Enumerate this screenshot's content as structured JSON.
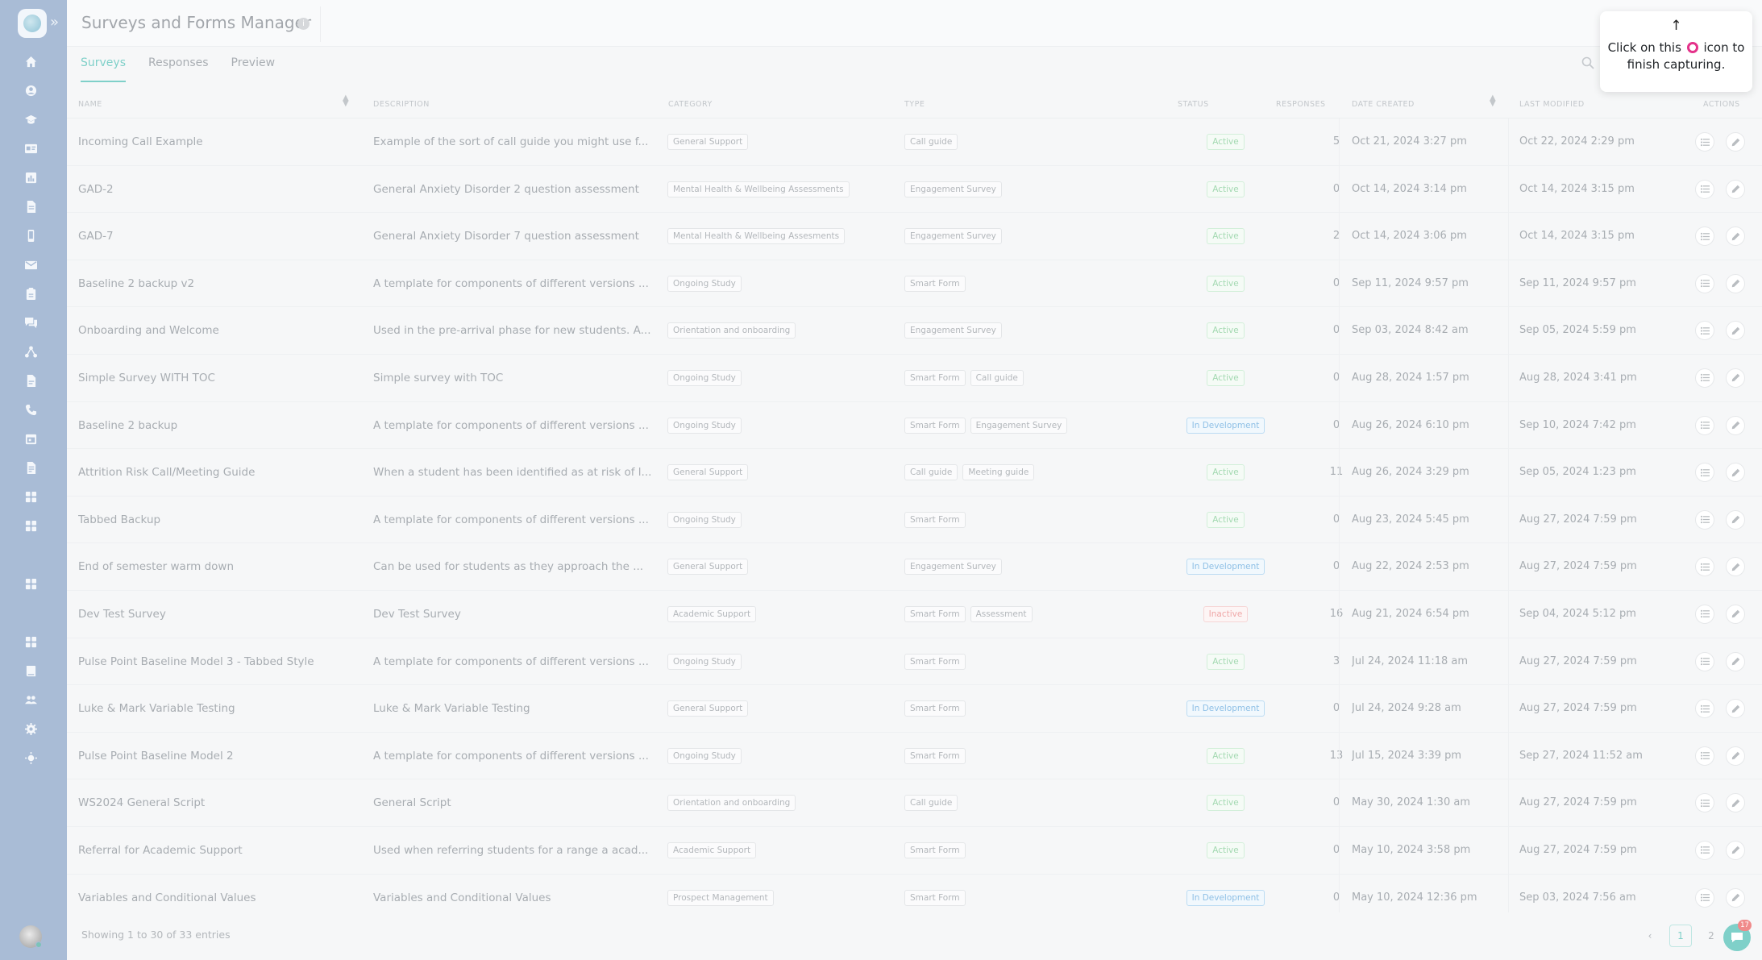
{
  "header": {
    "title": "Surveys and Forms Manager",
    "info_glyph": "i"
  },
  "tabs": [
    "Surveys",
    "Responses",
    "Preview"
  ],
  "columns": {
    "name": "NAME",
    "description": "DESCRIPTION",
    "category": "CATEGORY",
    "type": "TYPE",
    "status": "STATUS",
    "responses": "RESPONSES",
    "date_created": "DATE CREATED",
    "last_modified": "LAST MODIFIED",
    "actions": "ACTIONS"
  },
  "rows": [
    {
      "name": "Incoming Call Example",
      "description": "Example of the sort of call guide you might use f...",
      "category": "General Support",
      "types": [
        "Call guide"
      ],
      "status": "Active",
      "responses": "5",
      "created": "Oct 21, 2024 3:27 pm",
      "modified": "Oct 22, 2024 2:29 pm"
    },
    {
      "name": "GAD-2",
      "description": "General Anxiety Disorder 2 question assessment",
      "category": "Mental Health & Wellbeing Assessments",
      "types": [
        "Engagement Survey"
      ],
      "status": "Active",
      "responses": "0",
      "created": "Oct 14, 2024 3:14 pm",
      "modified": "Oct 14, 2024 3:15 pm"
    },
    {
      "name": "GAD-7",
      "description": "General Anxiety Disorder 7 question assessment",
      "category": "Mental Health & Wellbeing Assesments",
      "types": [
        "Engagement Survey"
      ],
      "status": "Active",
      "responses": "2",
      "created": "Oct 14, 2024 3:06 pm",
      "modified": "Oct 14, 2024 3:15 pm"
    },
    {
      "name": "Baseline 2 backup v2",
      "description": "A template for components of different versions ...",
      "category": "Ongoing Study",
      "types": [
        "Smart Form"
      ],
      "status": "Active",
      "responses": "0",
      "created": "Sep 11, 2024 9:57 pm",
      "modified": "Sep 11, 2024 9:57 pm"
    },
    {
      "name": "Onboarding and Welcome",
      "description": "Used in the pre-arrival phase for new students. A...",
      "category": "Orientation and onboarding",
      "types": [
        "Engagement Survey"
      ],
      "status": "Active",
      "responses": "0",
      "created": "Sep 03, 2024 8:42 am",
      "modified": "Sep 05, 2024 5:59 pm"
    },
    {
      "name": "Simple Survey WITH TOC",
      "description": "Simple survey with TOC",
      "category": "Ongoing Study",
      "types": [
        "Smart Form",
        "Call guide"
      ],
      "status": "Active",
      "responses": "0",
      "created": "Aug 28, 2024 1:57 pm",
      "modified": "Aug 28, 2024 3:41 pm"
    },
    {
      "name": "Baseline 2 backup",
      "description": "A template for components of different versions ...",
      "category": "Ongoing Study",
      "types": [
        "Smart Form",
        "Engagement Survey"
      ],
      "status": "In Development",
      "responses": "0",
      "created": "Aug 26, 2024 6:10 pm",
      "modified": "Sep 10, 2024 7:42 pm"
    },
    {
      "name": "Attrition Risk Call/Meeting Guide",
      "description": "When a student has been identified as at risk of l...",
      "category": "General Support",
      "types": [
        "Call guide",
        "Meeting guide"
      ],
      "status": "Active",
      "responses": "11",
      "created": "Aug 26, 2024 3:29 pm",
      "modified": "Sep 05, 2024 1:23 pm"
    },
    {
      "name": "Tabbed Backup",
      "description": "A template for components of different versions ...",
      "category": "Ongoing Study",
      "types": [
        "Smart Form"
      ],
      "status": "Active",
      "responses": "0",
      "created": "Aug 23, 2024 5:45 pm",
      "modified": "Aug 27, 2024 7:59 pm"
    },
    {
      "name": "End of semester warm down",
      "description": "Can be used for students as they approach the ...",
      "category": "General Support",
      "types": [
        "Engagement Survey"
      ],
      "status": "In Development",
      "responses": "0",
      "created": "Aug 22, 2024 2:53 pm",
      "modified": "Aug 27, 2024 7:59 pm"
    },
    {
      "name": "Dev Test Survey",
      "description": "Dev Test Survey",
      "category": "Academic Support",
      "types": [
        "Smart Form",
        "Assessment"
      ],
      "status": "Inactive",
      "responses": "16",
      "created": "Aug 21, 2024 6:54 pm",
      "modified": "Sep 04, 2024 5:12 pm"
    },
    {
      "name": "Pulse Point Baseline Model 3 - Tabbed Style",
      "description": "A template for components of different versions ...",
      "category": "Ongoing Study",
      "types": [
        "Smart Form"
      ],
      "status": "Active",
      "responses": "3",
      "created": "Jul 24, 2024 11:18 am",
      "modified": "Aug 27, 2024 7:59 pm"
    },
    {
      "name": "Luke & Mark Variable Testing",
      "description": "Luke & Mark Variable Testing",
      "category": "General Support",
      "types": [
        "Smart Form"
      ],
      "status": "In Development",
      "responses": "0",
      "created": "Jul 24, 2024 9:28 am",
      "modified": "Aug 27, 2024 7:59 pm"
    },
    {
      "name": "Pulse Point Baseline Model 2",
      "description": "A template for components of different versions ...",
      "category": "Ongoing Study",
      "types": [
        "Smart Form"
      ],
      "status": "Active",
      "responses": "13",
      "created": "Jul 15, 2024 3:39 pm",
      "modified": "Sep 27, 2024 11:52 am"
    },
    {
      "name": "WS2024 General Script",
      "description": "General Script",
      "category": "Orientation and onboarding",
      "types": [
        "Call guide"
      ],
      "status": "Active",
      "responses": "0",
      "created": "May 30, 2024 1:30 am",
      "modified": "Aug 27, 2024 7:59 pm"
    },
    {
      "name": "Referral for Academic Support",
      "description": "Used when referring students for a range a acad...",
      "category": "Academic Support",
      "types": [
        "Smart Form"
      ],
      "status": "Active",
      "responses": "0",
      "created": "May 10, 2024 3:58 pm",
      "modified": "Aug 27, 2024 7:59 pm"
    },
    {
      "name": "Variables and Conditional Values",
      "description": "Variables and Conditional Values",
      "category": "Prospect Management",
      "types": [
        "Smart Form"
      ],
      "status": "In Development",
      "responses": "0",
      "created": "May 10, 2024 12:36 pm",
      "modified": "Sep 03, 2024 7:56 am"
    }
  ],
  "footer": {
    "entries_text": "Showing 1 to 30 of 33 entries",
    "prev_label": "‹",
    "pages": [
      "1",
      "2"
    ],
    "current_page": "1",
    "chat_badge": "17"
  },
  "tooltip": {
    "arrow": "↑",
    "text_before": "Click on this",
    "text_after": "icon to finish capturing."
  },
  "colors": {
    "sidebar": "#a9bcd6",
    "accent": "#7fd0c9",
    "status_active": "#a3d9b1",
    "status_dev": "#8fc0e6",
    "status_inactive": "#efa7a7",
    "record_icon": "#e4328a"
  },
  "icons": {
    "sidebar": [
      "home-icon",
      "user-icon",
      "graduation-cap-icon",
      "id-card-icon",
      "chart-icon",
      "document-icon",
      "mobile-icon",
      "envelope-icon",
      "clipboard-icon",
      "chat-icon",
      "network-icon",
      "file-icon",
      "phone-icon",
      "calendar-icon",
      "file-alt-icon",
      "apps-icon",
      "apps-icon",
      "apps-icon",
      "apps-icon",
      "book-icon",
      "users-icon",
      "gear-icon",
      "lightbulb-icon"
    ]
  }
}
